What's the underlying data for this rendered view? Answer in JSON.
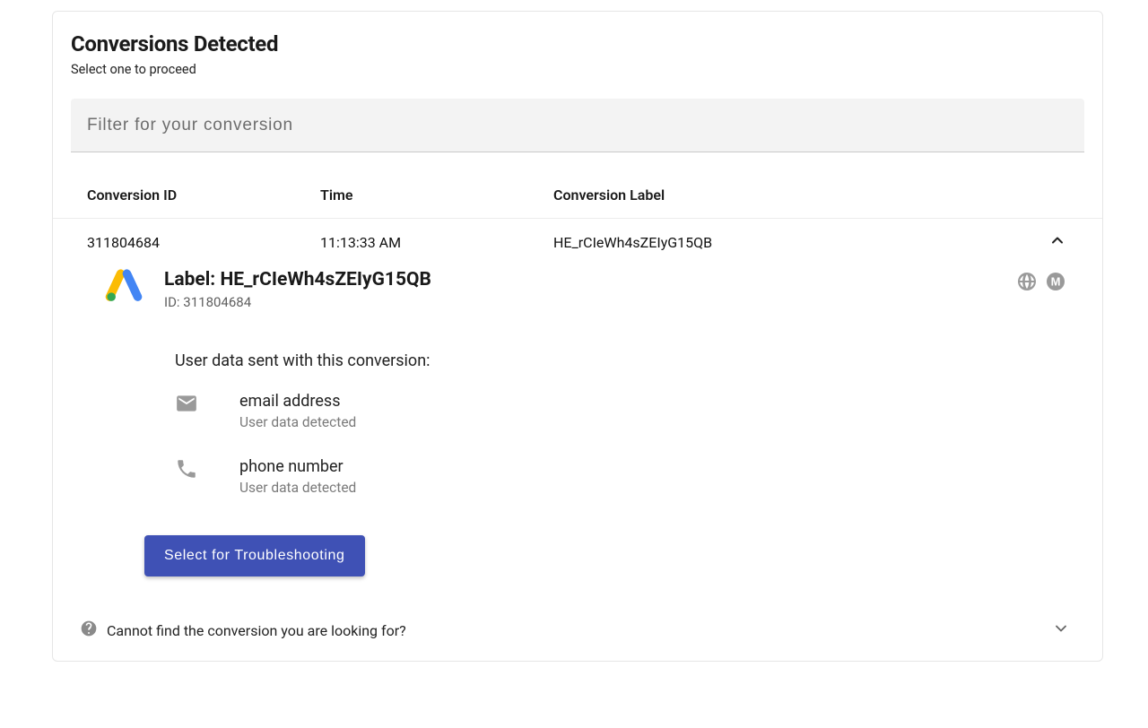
{
  "header": {
    "title": "Conversions Detected",
    "subtitle": "Select one to proceed"
  },
  "filter": {
    "placeholder": "Filter for your conversion"
  },
  "columns": {
    "id": "Conversion ID",
    "time": "Time",
    "label": "Conversion Label"
  },
  "row": {
    "id": "311804684",
    "time": "11:13:33 AM",
    "label": "HE_rCIeWh4sZEIyG15QB"
  },
  "detail": {
    "label_title": "Label: HE_rCIeWh4sZEIyG15QB",
    "id_line": "ID: 311804684",
    "userdata_title": "User data sent with this conversion:",
    "items": {
      "email": {
        "name": "email address",
        "sub": "User data detected"
      },
      "phone": {
        "name": "phone number",
        "sub": "User data detected"
      }
    },
    "button": "Select for Troubleshooting"
  },
  "footer": {
    "text": "Cannot find the conversion you are looking for?"
  }
}
